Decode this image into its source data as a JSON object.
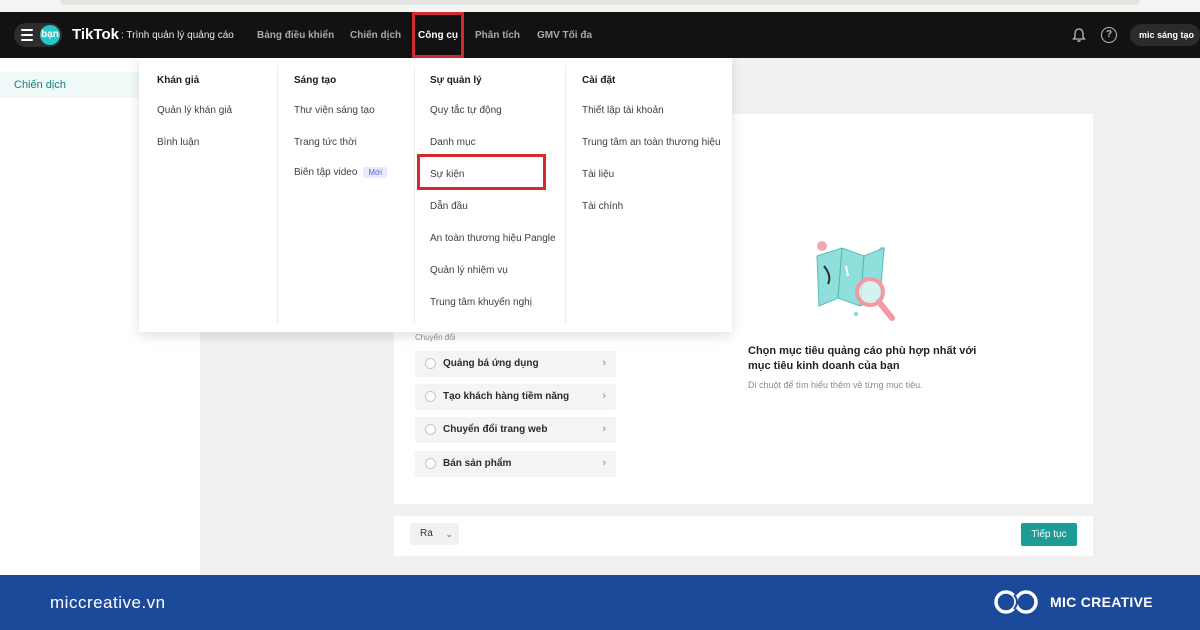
{
  "header": {
    "avatar_text": "bạn",
    "brand": "TikTok",
    "brand_sub": ": Trình quản lý quảng cáo",
    "nav": [
      {
        "label": "Bảng điều khiển"
      },
      {
        "label": "Chiến dịch"
      },
      {
        "label": "Công cụ"
      },
      {
        "label": "Phân tích"
      },
      {
        "label": "GMV Tối đa"
      }
    ],
    "help_glyph": "?",
    "account": "mic sáng tạo"
  },
  "sidebar": {
    "active_item": "Chiến dịch"
  },
  "mega_menu": {
    "columns": [
      {
        "heading": "Khán giả",
        "items": [
          "Quản lý khán giả",
          "Bình luận"
        ]
      },
      {
        "heading": "Sáng tạo",
        "items": [
          "Thư viện sáng tạo",
          "Trang tức thời",
          "Biên tập video"
        ],
        "new_badge": "Mới"
      },
      {
        "heading": "Sự quản lý",
        "items": [
          "Quy tắc tự động",
          "Danh mục",
          "Sự kiện",
          "Dẫn đầu",
          "An toàn thương hiệu Pangle",
          "Quản lý nhiệm vụ",
          "Trung tâm khuyến nghị"
        ]
      },
      {
        "heading": "Cài đặt",
        "items": [
          "Thiết lập tài khoản",
          "Trung tâm an toàn thương hiệu",
          "Tài liệu",
          "Tài chính"
        ]
      }
    ]
  },
  "objectives": {
    "section": "Chuyển đổi",
    "items": [
      "Quảng bá ứng dụng",
      "Tạo khách hàng tiềm năng",
      "Chuyển đổi trang web",
      "Bán sản phẩm"
    ],
    "chevron": "›"
  },
  "empty_state": {
    "title": "Chọn mục tiêu quảng cáo phù hợp nhất với mục tiêu kinh doanh của bạn",
    "subtitle": "Di chuột để tìm hiểu thêm về từng mục tiêu."
  },
  "footer": {
    "select_value": "Ra",
    "select_chevron": "⌄",
    "continue": "Tiếp tục"
  },
  "banner": {
    "domain": "miccreative.vn",
    "brand": "MIC CREATIVE"
  },
  "colors": {
    "accent": "#1d9b96",
    "highlight": "#d42a2f",
    "banner": "#1c4a9a",
    "nav_bg": "#121212"
  }
}
